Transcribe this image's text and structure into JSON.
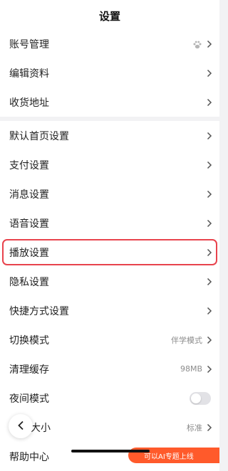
{
  "header": {
    "title": "设置"
  },
  "account_group": [
    {
      "label": "账号管理",
      "icon": "paw-icon"
    },
    {
      "label": "编辑资料"
    },
    {
      "label": "收货地址"
    }
  ],
  "settings_group": [
    {
      "label": "默认首页设置"
    },
    {
      "label": "支付设置"
    },
    {
      "label": "消息设置"
    },
    {
      "label": "语音设置"
    },
    {
      "label": "播放设置"
    },
    {
      "label": "隐私设置"
    },
    {
      "label": "快捷方式设置"
    },
    {
      "label": "切换模式",
      "value": "伴学模式"
    },
    {
      "label": "清理缓存",
      "value": "98MB"
    },
    {
      "label": "夜间模式",
      "toggle_on": false
    },
    {
      "label": "大小",
      "value": "标准"
    },
    {
      "label": "帮助中心"
    }
  ],
  "promo": {
    "text": "可以AI专题上线"
  },
  "colors": {
    "highlight_border": "#e8434d",
    "background": "#f2f2f4",
    "promo": "#ff5a2b"
  }
}
